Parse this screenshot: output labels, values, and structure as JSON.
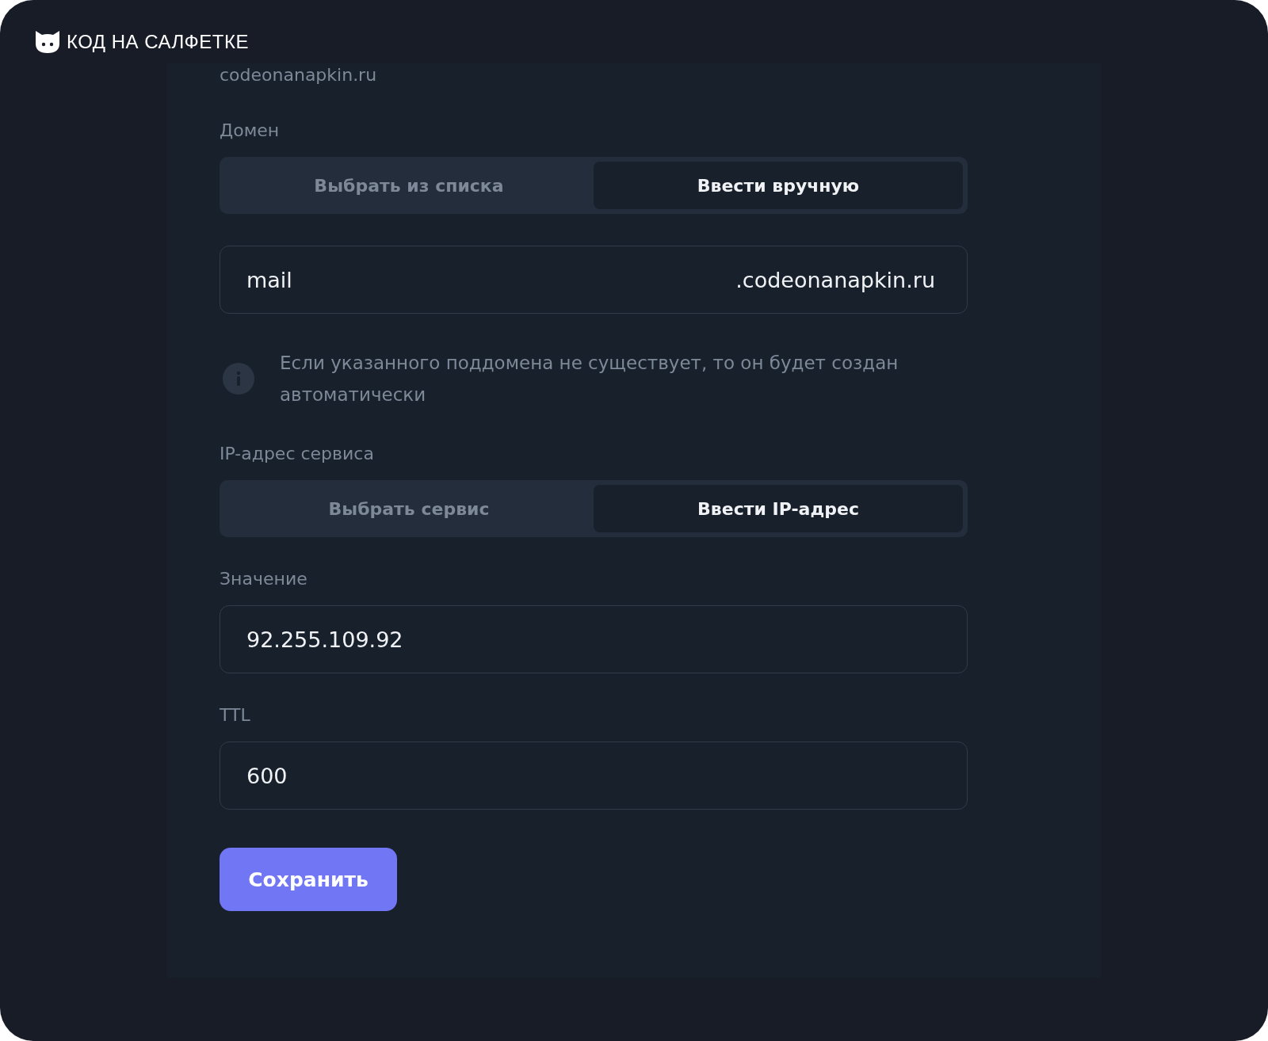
{
  "brand": {
    "name": "КОД НА САЛФЕТКЕ"
  },
  "cut_text": "codeonanapkin.ru",
  "fields": [
    {
      "kind": "segmented",
      "label": "Домен",
      "options": [
        {
          "label": "Выбрать из списка",
          "selected": false
        },
        {
          "label": "Ввести вручную",
          "selected": true
        }
      ]
    },
    {
      "kind": "suffix_input",
      "value": "mail",
      "suffix": ".codeonanapkin.ru"
    },
    {
      "kind": "info",
      "text": "Если указанного поддомена не существует, то он будет создан автоматически"
    },
    {
      "kind": "segmented",
      "label": "IP-адрес сервиса",
      "options": [
        {
          "label": "Выбрать сервис",
          "selected": false
        },
        {
          "label": "Ввести IP-адрес",
          "selected": true
        }
      ]
    },
    {
      "kind": "input",
      "label": "Значение",
      "value": "92.255.109.92"
    },
    {
      "kind": "input",
      "label": "TTL",
      "value": "600"
    }
  ],
  "save_button": "Сохранить"
}
